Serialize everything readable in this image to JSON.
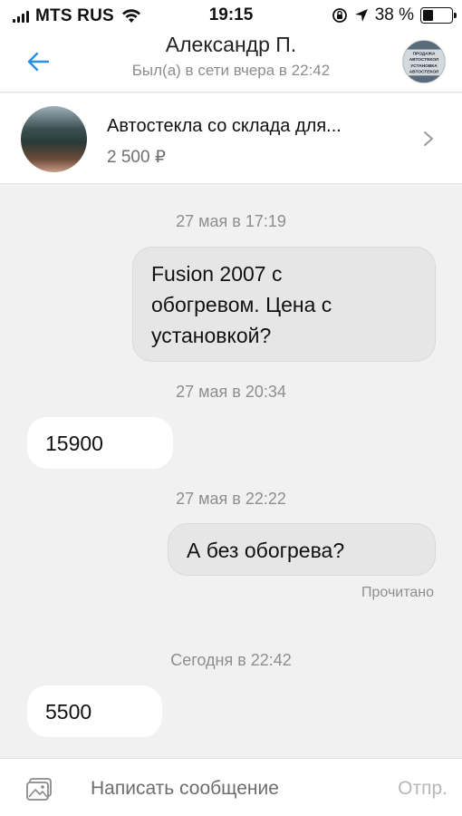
{
  "status_bar": {
    "carrier": "MTS RUS",
    "time": "19:15",
    "battery": "38 %",
    "battery_level": 0.38
  },
  "header": {
    "title": "Александр П.",
    "subtitle": "Был(а) в сети вчера в 22:42",
    "avatar_text": [
      "ПРОДАЖА",
      "АВТОСТЕКОЛ",
      "УСТАНОВКА",
      "АВТОСТЕКОЛ"
    ]
  },
  "product": {
    "title": "Автостекла со склада для...",
    "price": "2 500 ₽"
  },
  "messages": [
    {
      "date": "27 мая в 17:19",
      "text": "Fusion 2007 с\nобогревом. Цена с\nустановкой?",
      "direction": "out"
    },
    {
      "date": "27 мая в 20:34",
      "text": "15900",
      "direction": "in"
    },
    {
      "date": "27 мая в 22:22",
      "text": "А без обогрева?",
      "direction": "out",
      "status": "Прочитано"
    },
    {
      "date": "Сегодня в 22:42",
      "text": "5500",
      "direction": "in"
    }
  ],
  "composer": {
    "placeholder": "Написать сообщение",
    "send_label": "Отпр."
  },
  "colors": {
    "accent": "#2a8ee8",
    "bubble_out": "#e6e6e6",
    "bubble_in": "#ffffff",
    "muted": "#8e8e8e"
  }
}
